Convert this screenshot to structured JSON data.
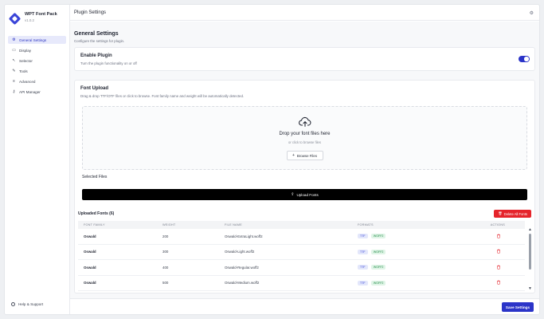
{
  "app": {
    "name": "WPT Font Pack",
    "version": "v1.0.2"
  },
  "sidebar": {
    "items": [
      {
        "label": "General Settings",
        "icon": "gear-icon",
        "active": true
      },
      {
        "label": "Display",
        "icon": "monitor-icon",
        "active": false
      },
      {
        "label": "Selector",
        "icon": "cursor-icon",
        "active": false
      },
      {
        "label": "Tools",
        "icon": "wrench-icon",
        "active": false
      },
      {
        "label": "Advanced",
        "icon": "sliders-icon",
        "active": false
      },
      {
        "label": "API Manager",
        "icon": "key-icon",
        "active": false
      }
    ],
    "help_label": "Help & Support"
  },
  "header": {
    "title": "Plugin Settings"
  },
  "general": {
    "title": "General Settings",
    "subtitle": "Configure the settings for plugin."
  },
  "enable_plugin": {
    "title": "Enable Plugin",
    "description": "Turn the plugin functionality on or off",
    "enabled": true
  },
  "font_upload": {
    "title": "Font Upload",
    "description": "Drag & drop TTF/OTF files or click to browse. Font family name and weight will be automatically detected.",
    "drop_title": "Drop your font files here",
    "drop_sub": "or click to browse files",
    "browse_label": "Browse Files",
    "selected_files_label": "Selected Files",
    "upload_label": "Upload Fonts"
  },
  "uploaded": {
    "title": "Uploaded Fonts (6)",
    "delete_all_label": "Delete All Fonts",
    "columns": [
      "FONT FAMILY",
      "WEIGHT",
      "FILE NAME",
      "FORMATS",
      "ACTIONS"
    ],
    "rows": [
      {
        "family": "Oswald",
        "weight": "200",
        "file": "Oswald-ExtraLight.woff2",
        "formats": [
          "TTF",
          "WOFF2"
        ]
      },
      {
        "family": "Oswald",
        "weight": "300",
        "file": "Oswald-Light.woff2",
        "formats": [
          "TTF",
          "WOFF2"
        ]
      },
      {
        "family": "Oswald",
        "weight": "400",
        "file": "Oswald-Regular.woff2",
        "formats": [
          "TTF",
          "WOFF2"
        ]
      },
      {
        "family": "Oswald",
        "weight": "500",
        "file": "Oswald-Medium.woff2",
        "formats": [
          "TTF",
          "WOFF2"
        ]
      }
    ]
  },
  "footer": {
    "save_label": "Save Settings"
  },
  "colors": {
    "accent": "#2b34c8",
    "danger": "#e5242b",
    "upload_button": "#000000"
  }
}
